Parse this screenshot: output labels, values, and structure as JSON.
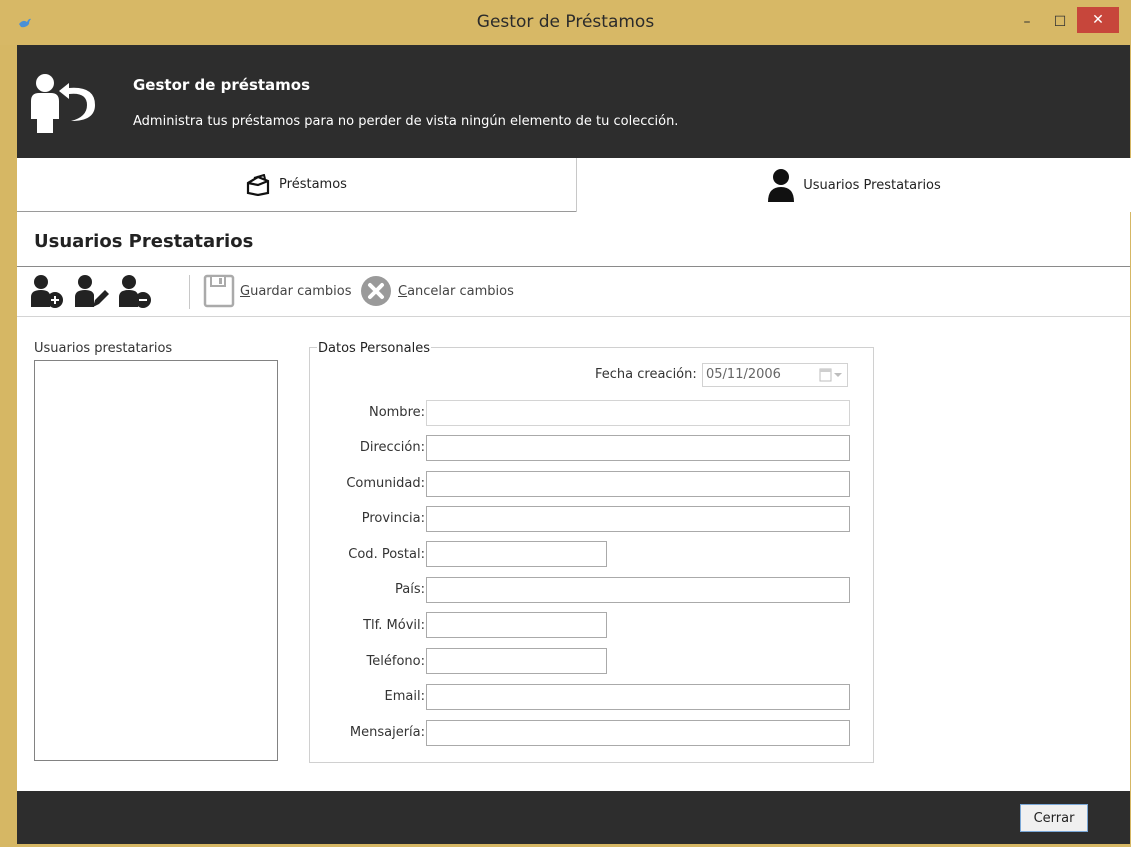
{
  "window": {
    "title": "Gestor de Préstamos",
    "minimize_glyph": "–",
    "maximize_glyph": "☐",
    "close_glyph": "✕"
  },
  "banner": {
    "title": "Gestor de préstamos",
    "subtitle": "Administra tus préstamos para no perder de vista ningún elemento de tu colección.",
    "icon": "user-return-icon"
  },
  "tabs": [
    {
      "label": "Préstamos",
      "icon": "box-icon"
    },
    {
      "label": "Usuarios Prestatarios",
      "icon": "user-icon"
    }
  ],
  "section": {
    "title": "Usuarios Prestatarios"
  },
  "toolbar": {
    "add_user_icon": "user-add-icon",
    "edit_user_icon": "user-edit-icon",
    "remove_user_icon": "user-remove-icon",
    "save_mnemonic": "G",
    "save_rest": "uardar cambios",
    "cancel_mnemonic": "C",
    "cancel_rest": "ancelar cambios"
  },
  "list": {
    "label": "Usuarios prestatarios"
  },
  "form": {
    "legend": "Datos Personales",
    "fecha_label": "Fecha creación:",
    "fecha_value": "05/11/2006",
    "fields": [
      {
        "label": "Nombre:",
        "value": ""
      },
      {
        "label": "Dirección:",
        "value": ""
      },
      {
        "label": "Comunidad:",
        "value": ""
      },
      {
        "label": "Provincia:",
        "value": ""
      },
      {
        "label": "Cod. Postal:",
        "value": ""
      },
      {
        "label": "País:",
        "value": ""
      },
      {
        "label": "Tlf. Móvil:",
        "value": ""
      },
      {
        "label": "Teléfono:",
        "value": ""
      },
      {
        "label": "Email:",
        "value": ""
      },
      {
        "label": "Mensajería:",
        "value": ""
      }
    ]
  },
  "footer": {
    "close_label": "Cerrar"
  },
  "colors": {
    "window_frame": "#d7b866",
    "banner_bg": "#2d2d2d",
    "close_button": "#c7463b"
  }
}
